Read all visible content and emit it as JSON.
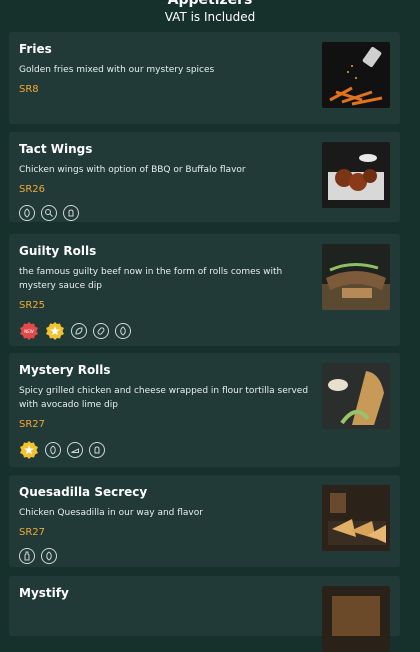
{
  "header": {
    "title": "Appetizers",
    "subtitle": "VAT is Included"
  },
  "colors": {
    "background": "#16302c",
    "card": "#213a37",
    "price": "#f2a736",
    "badge_new": "#e04a4a",
    "badge_star": "#f2c230"
  },
  "items": [
    {
      "name": "Fries",
      "description": "Golden fries mixed with our mystery spices",
      "price": "SR8",
      "tags": []
    },
    {
      "name": "Tact Wings",
      "description": "Chicken wings with option of BBQ or Buffalo flavor",
      "price": "SR26",
      "tags": [
        "chili-icon",
        "chicken-leg-icon",
        "rooster-icon"
      ]
    },
    {
      "name": "Guilty Rolls",
      "description": "the famous guilty beef now in the form of rolls comes with mystery sauce dip",
      "price": "SR25",
      "badges": [
        "new-badge",
        "star-badge"
      ],
      "badge_new_text": "NEW",
      "tags": [
        "leaf-icon",
        "pickle-icon",
        "chili-icon"
      ]
    },
    {
      "name": "Mystery Rolls",
      "description": "Spicy grilled chicken and cheese wrapped in flour tortilla served with avocado lime dip",
      "price": "SR27",
      "badges": [
        "star-badge"
      ],
      "tags": [
        "chili-icon",
        "cheese-icon",
        "rooster-icon"
      ]
    },
    {
      "name": "Quesadilla Secrecy",
      "description": "Chicken Quesadilla in our way and flavor",
      "price": "SR27",
      "tags": [
        "bottle-icon",
        "chili-icon"
      ]
    },
    {
      "name": "Mystify",
      "description": "",
      "price": "",
      "tags": []
    }
  ]
}
